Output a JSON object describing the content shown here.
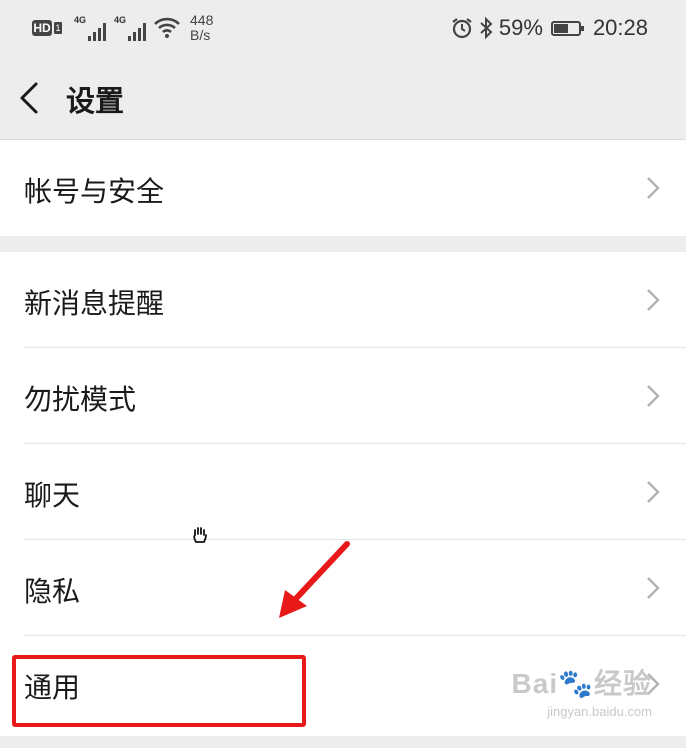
{
  "status_bar": {
    "hd_label": "HD",
    "sim1_tag": "4G",
    "sim2_tag": "4G",
    "net_speed_value": "448",
    "net_speed_unit": "B/s",
    "battery_percent": "59%",
    "battery_level": 0.59,
    "time": "20:28"
  },
  "header": {
    "title": "设置"
  },
  "groups": [
    {
      "items": [
        {
          "label": "帐号与安全"
        }
      ]
    },
    {
      "items": [
        {
          "label": "新消息提醒"
        },
        {
          "label": "勿扰模式"
        },
        {
          "label": "聊天"
        },
        {
          "label": "隐私"
        },
        {
          "label": "通用"
        }
      ]
    }
  ],
  "watermark": {
    "main": "Bai",
    "main2": "经验",
    "sub": "jingyan.baidu.com"
  },
  "colors": {
    "background": "#ededed",
    "list_background": "#ffffff",
    "highlight": "#e81919"
  }
}
